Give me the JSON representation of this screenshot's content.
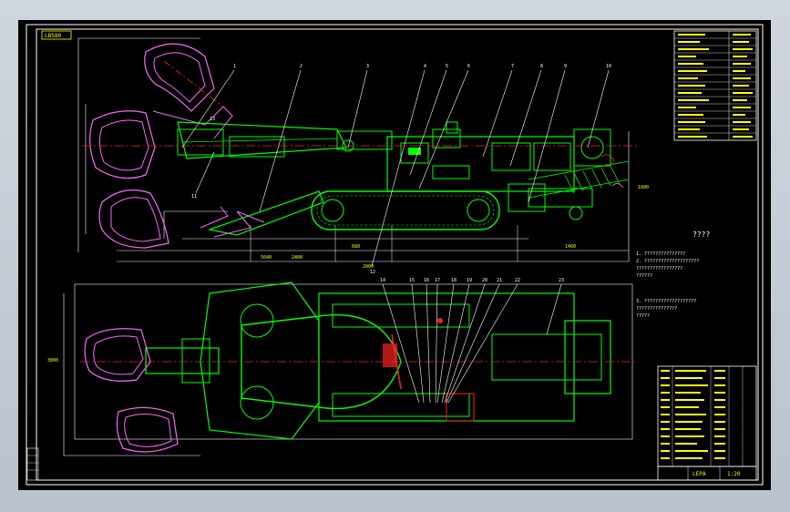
{
  "drawing": {
    "header_tag": "LB580",
    "caption": "????",
    "title_block_name": "LEPA",
    "title_block_code": "1:20",
    "notes": [
      "1. ???????????????",
      "2. ????????????????????",
      "   ?????????????????",
      "   ??????",
      "3. ???????????????????",
      "   ???????????????",
      "   ?????"
    ],
    "dimensions_side": [
      "5640",
      "2400",
      "680",
      "1460",
      "2000",
      "1600"
    ],
    "dimensions_plan": [
      "3800"
    ],
    "balloons_side": [
      "1",
      "2",
      "3",
      "4",
      "5",
      "6",
      "7",
      "8",
      "9",
      "10",
      "11",
      "12",
      "13"
    ],
    "balloons_plan": [
      "14",
      "15",
      "16",
      "17",
      "18",
      "19",
      "20",
      "21",
      "22",
      "23"
    ],
    "colors": {
      "outline": "#ffffff",
      "machine": "#00ff00",
      "cutter": "#ff66ff",
      "centerline": "#ff2020",
      "annotation": "#ffff00",
      "viewport": "#000000"
    }
  }
}
